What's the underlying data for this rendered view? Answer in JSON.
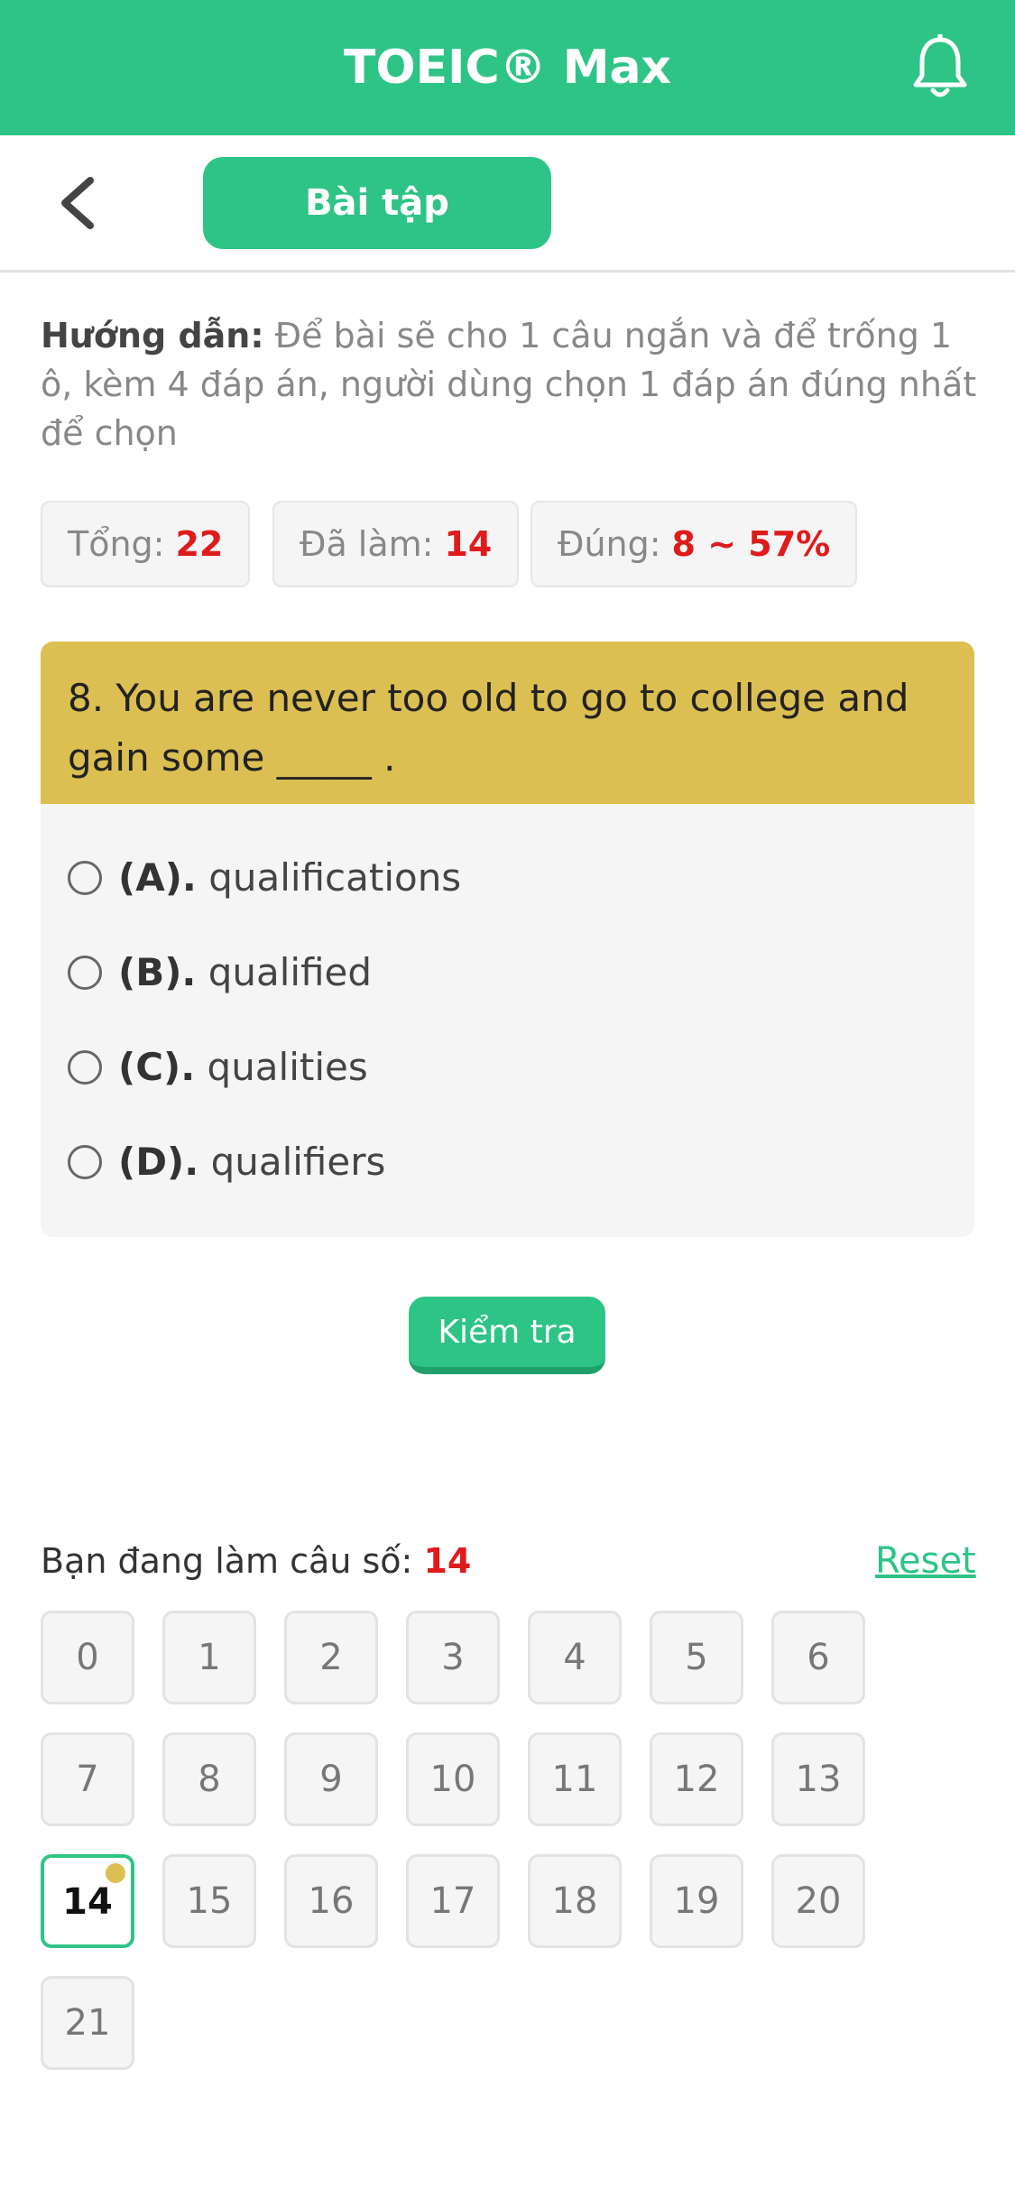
{
  "header": {
    "title": "TOEIC® Max",
    "notification_icon": "bell-icon"
  },
  "subbar": {
    "back_icon": "chevron-left-icon",
    "tab_label": "Bài tập"
  },
  "instructions": {
    "label": "Hướng dẫn:",
    "text": "Để bài sẽ cho 1 câu ngắn và để trống 1 ô, kèm 4 đáp án, người dùng chọn 1 đáp án đúng nhất để chọn"
  },
  "stats": {
    "total_label": "Tổng:",
    "total_value": "22",
    "done_label": "Đã làm:",
    "done_value": "14",
    "correct_label": "Đúng:",
    "correct_value": "8 ~ 57%"
  },
  "question": {
    "text": "8. You are never too old to go to college and gain some _____ .",
    "options": [
      {
        "key": "(A).",
        "text": "qualifications"
      },
      {
        "key": "(B).",
        "text": "qualified"
      },
      {
        "key": "(C).",
        "text": "qualities"
      },
      {
        "key": "(D).",
        "text": "qualifiers"
      }
    ]
  },
  "check_button": "Kiểm tra",
  "progress": {
    "label": "Bạn đang làm câu số:",
    "current": "14",
    "reset": "Reset"
  },
  "question_numbers": [
    "0",
    "1",
    "2",
    "3",
    "4",
    "5",
    "6",
    "7",
    "8",
    "9",
    "10",
    "11",
    "12",
    "13",
    "14",
    "15",
    "16",
    "17",
    "18",
    "19",
    "20",
    "21"
  ],
  "colors": {
    "primary": "#2ec486",
    "question_bg": "#dcbf52",
    "highlight": "#e01b1b"
  }
}
